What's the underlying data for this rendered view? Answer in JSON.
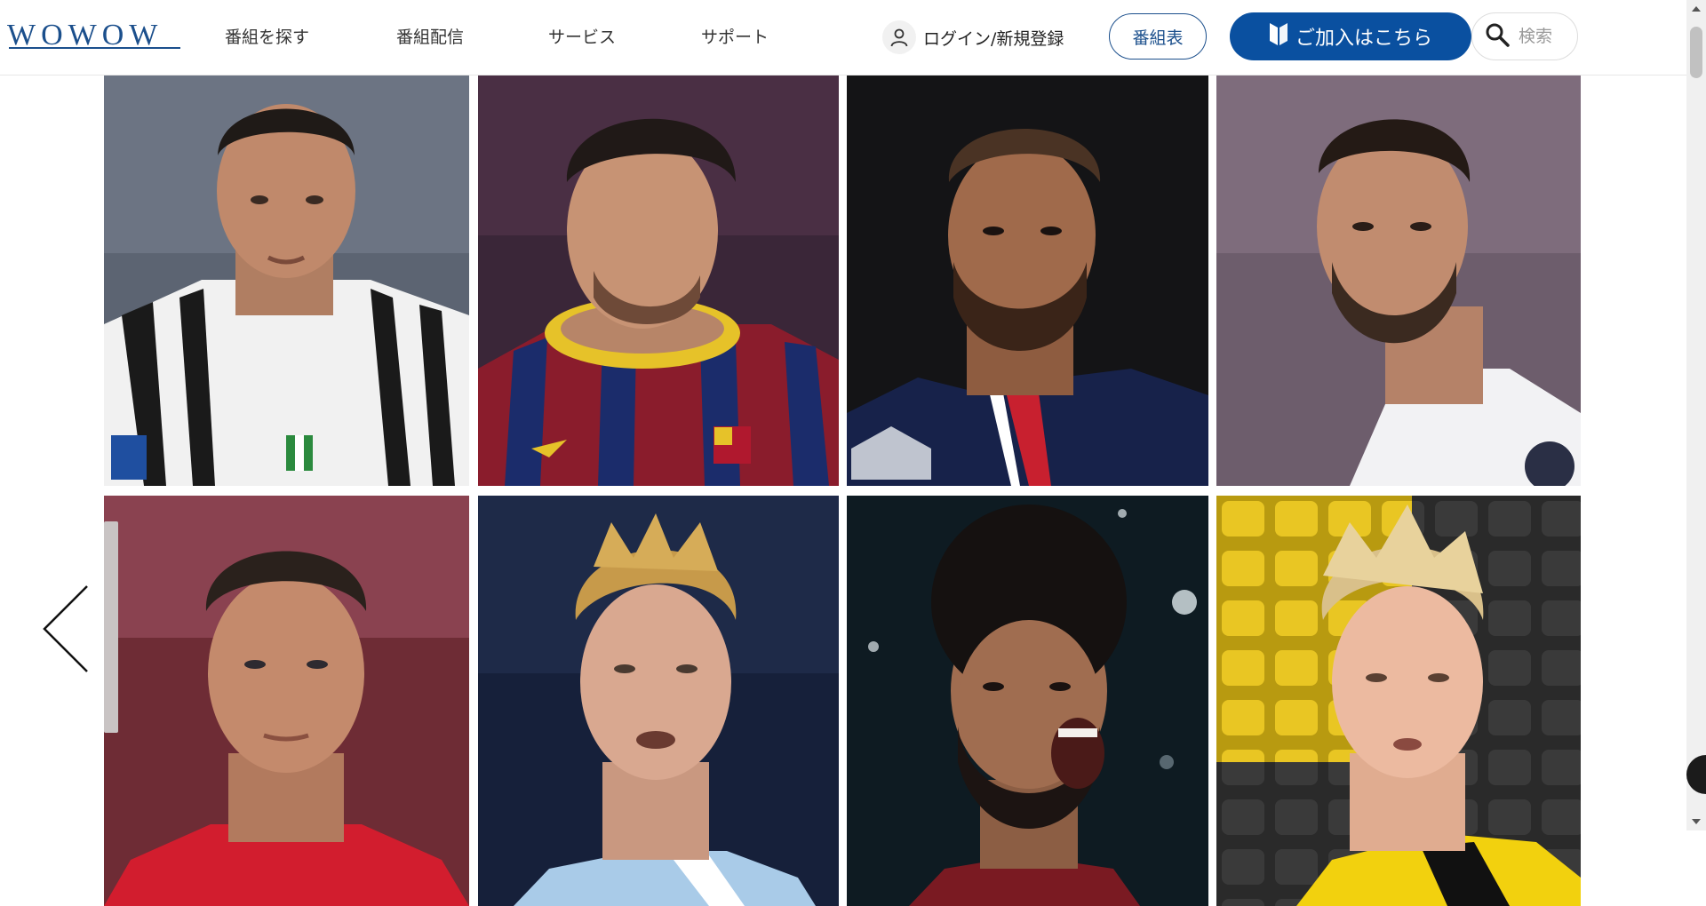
{
  "header": {
    "logo_text": "WOWOW",
    "nav": [
      {
        "label": "番組を探す"
      },
      {
        "label": "番組配信"
      },
      {
        "label": "サービス"
      },
      {
        "label": "サポート"
      }
    ],
    "login_label": "ログイン/新規登録",
    "schedule_label": "番組表",
    "join_label": "ご加入はこちら",
    "search_placeholder": "検索"
  },
  "colors": {
    "brand_blue": "#0a50a0",
    "logo_blue": "#1b4f8c"
  },
  "icons": {
    "login": "user-icon",
    "join": "beginner-mark-icon",
    "search": "search-icon",
    "carousel_prev": "chevron-left-icon"
  },
  "photos": [
    {
      "name": "player-photo-1"
    },
    {
      "name": "player-photo-2"
    },
    {
      "name": "player-photo-3"
    },
    {
      "name": "player-photo-4"
    },
    {
      "name": "player-photo-5"
    },
    {
      "name": "player-photo-6"
    },
    {
      "name": "player-photo-7"
    },
    {
      "name": "player-photo-8"
    }
  ]
}
